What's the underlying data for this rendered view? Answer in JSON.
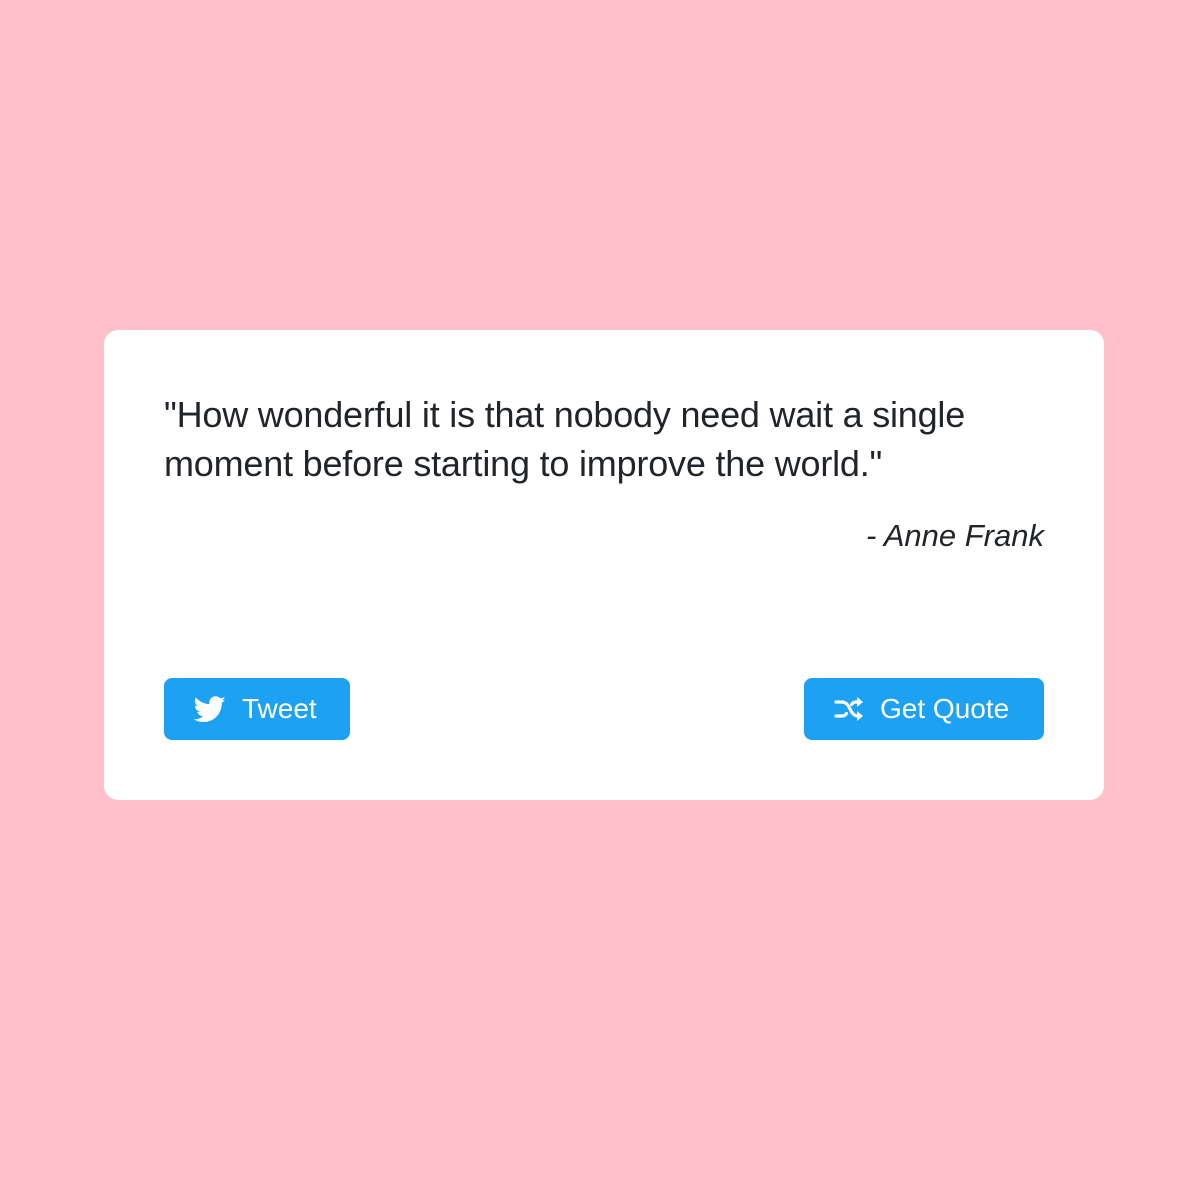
{
  "colors": {
    "background": "#ffc0cb",
    "card": "#ffffff",
    "text": "#212529",
    "button": "#1da1f2",
    "button_text": "#ffffff"
  },
  "quote": {
    "text": "\"How wonderful it is that nobody need wait a single moment before starting to improve the world.\"",
    "author": "- Anne Frank"
  },
  "buttons": {
    "tweet": {
      "label": "Tweet",
      "icon": "twitter-icon"
    },
    "get_quote": {
      "label": "Get Quote",
      "icon": "shuffle-icon"
    }
  }
}
